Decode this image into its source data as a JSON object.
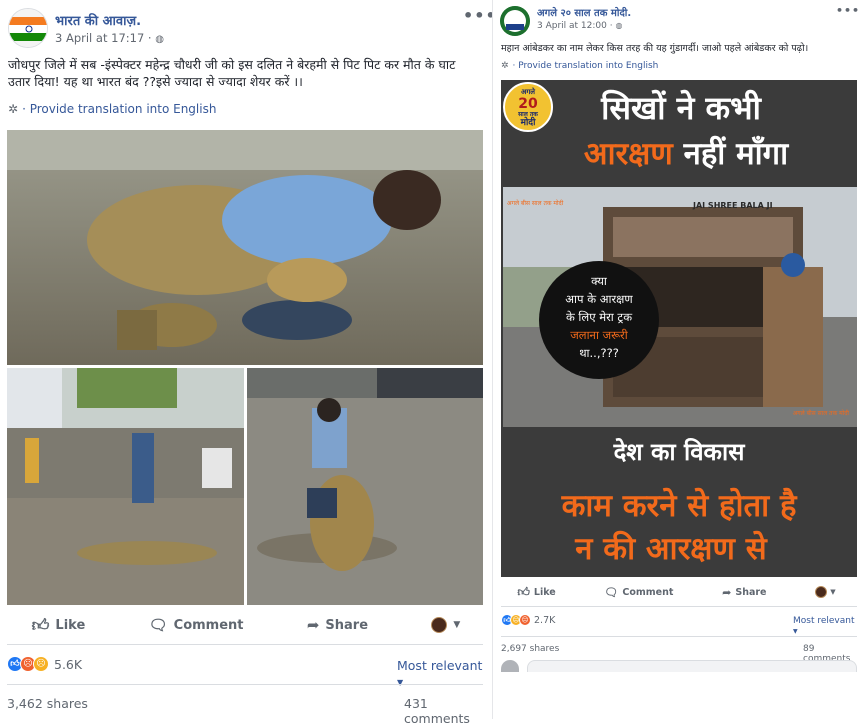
{
  "post1": {
    "page_name": "भारत की आवाज़.",
    "date": "3 April at 17:17 · ",
    "body": "जोधपुर जिले में सब -इंस्पेक्टर महेन्द्र चौधरी जी को इस दलित ने बेरहमी से पिट पिट कर मौत के घाट उतार दिया! यह था भारत बंद ??इसे ज्यादा से ज्यादा शेयर करें ।।",
    "translate": "· Provide translation into English",
    "like": "Like",
    "comment": "Comment",
    "share": "Share",
    "reactions_count": "5.6K",
    "sort": "Most relevant",
    "shares": "3,462 shares",
    "comments": "431 comments"
  },
  "post2": {
    "page_name": "अगले २० साल तक मोदी.",
    "date": "3 April at 12:00 · ",
    "body": "महान आंबेडकर का नाम लेकर किस तरह की यह गुंडागर्दी। जाओ पहले आंबेडकर को पढ़ो।",
    "translate": "· Provide translation into English",
    "poster": {
      "badge_top": "अगले",
      "badge_num": "20",
      "badge_mid": "साल तक",
      "badge_bottom": "मोदी",
      "headline1": "सिखों ने कभी",
      "headline2a": "आरक्षण",
      "headline2b": " नहीं माँगा",
      "watermark": "अगले बीस साल तक मोदी",
      "truck_sign": "JAI SHREE BALA JI",
      "bubble1": "क्या",
      "bubble2": "आप के आरक्षण",
      "bubble3": "के लिए मेरा ट्रक",
      "bubble4": "जलाना जरूरी",
      "bubble5": "था..,???",
      "footer_watermark": "अगले बीस साल तक मोदी",
      "sub1": "देश का विकास",
      "sub2": "काम करने से होता है",
      "sub3": "न की आरक्षण से"
    },
    "like": "Like",
    "comment": "Comment",
    "share": "Share",
    "reactions_count": "2.7K",
    "sort": "Most relevant",
    "shares": "2,697 shares",
    "comments": "89 comments"
  },
  "colors": {
    "fb_blue": "#365899",
    "poster_bg": "#3b3b3b",
    "poster_orange": "#f26a1b",
    "like_blue": "#2078f4",
    "angry_orange": "#f0622f",
    "sad_yellow": "#f7b125"
  }
}
